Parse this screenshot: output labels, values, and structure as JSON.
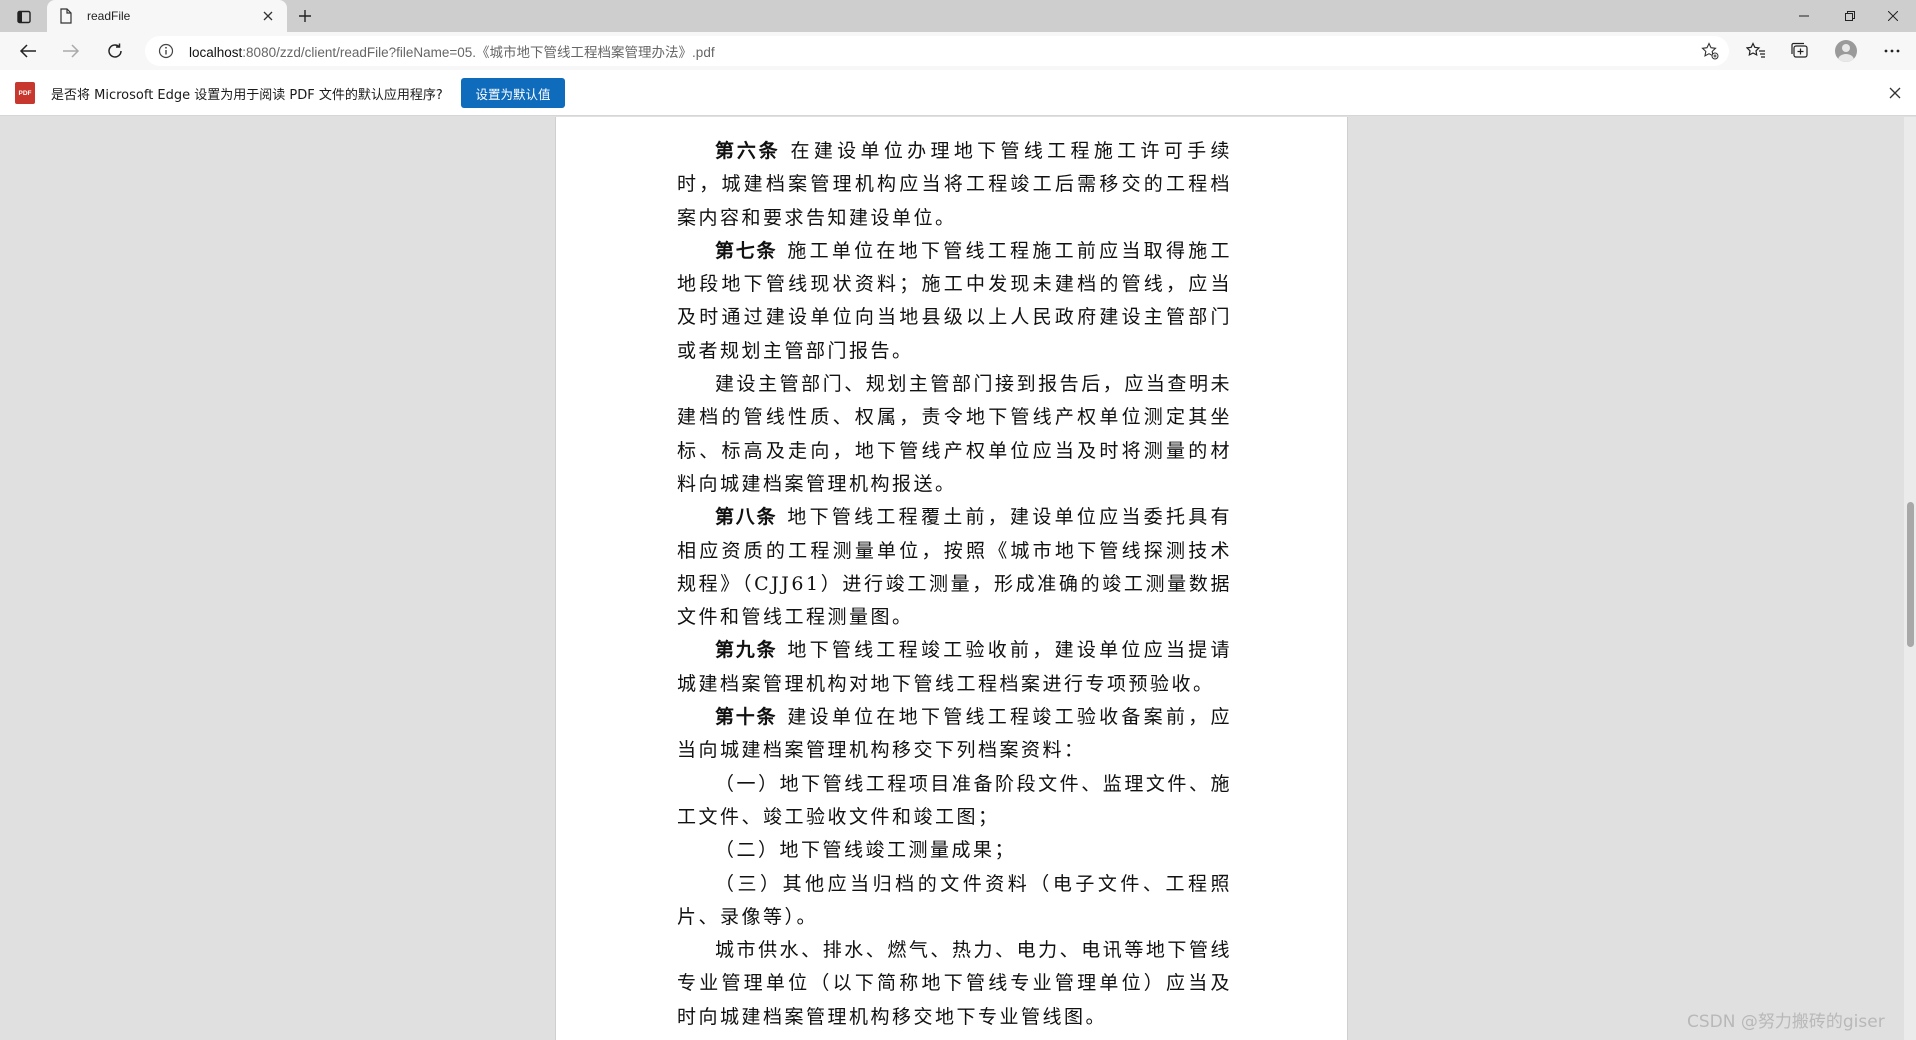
{
  "tab": {
    "title": "readFile"
  },
  "address": {
    "host": "localhost",
    "rest": ":8080/zzd/client/readFile?fileName=05.《城市地下管线工程档案管理办法》.pdf"
  },
  "infobar": {
    "icon_text": "PDF",
    "message": "是否将 Microsoft Edge 设置为用于阅读 PDF 文件的默认应用程序?",
    "button_label": "设置为默认值"
  },
  "document": {
    "paragraphs": [
      {
        "lead": "第六条",
        "text": "在建设单位办理地下管线工程施工许可手续时，城建档案管理机构应当将工程竣工后需移交的工程档案内容和要求告知建设单位。"
      },
      {
        "lead": "第七条",
        "text": "施工单位在地下管线工程施工前应当取得施工地段地下管线现状资料；施工中发现未建档的管线，应当及时通过建设单位向当地县级以上人民政府建设主管部门或者规划主管部门报告。"
      },
      {
        "lead": "",
        "text": "建设主管部门、规划主管部门接到报告后，应当查明未建档的管线性质、权属，责令地下管线产权单位测定其坐标、标高及走向，地下管线产权单位应当及时将测量的材料向城建档案管理机构报送。"
      },
      {
        "lead": "第八条",
        "text": "地下管线工程覆土前，建设单位应当委托具有相应资质的工程测量单位，按照《城市地下管线探测技术规程》（CJJ61）进行竣工测量，形成准确的竣工测量数据文件和管线工程测量图。"
      },
      {
        "lead": "第九条",
        "text": "地下管线工程竣工验收前，建设单位应当提请城建档案管理机构对地下管线工程档案进行专项预验收。"
      },
      {
        "lead": "第十条",
        "text": "建设单位在地下管线工程竣工验收备案前，应当向城建档案管理机构移交下列档案资料："
      },
      {
        "lead": "",
        "text": "（一）地下管线工程项目准备阶段文件、监理文件、施工文件、竣工验收文件和竣工图；"
      },
      {
        "lead": "",
        "text": "（二）地下管线竣工测量成果；"
      },
      {
        "lead": "",
        "text": "（三）其他应当归档的文件资料（电子文件、工程照片、录像等）。"
      },
      {
        "lead": "",
        "text": "城市供水、排水、燃气、热力、电力、电讯等地下管线专业管理单位（以下简称地下管线专业管理单位）应当及时向城建档案管理机构移交地下专业管线图。"
      }
    ]
  },
  "watermark": "CSDN @努力搬砖的giser",
  "colors": {
    "accent": "#0f6cbd",
    "pdf_icon": "#c8372d",
    "viewer_bg": "#e0e0e0"
  }
}
